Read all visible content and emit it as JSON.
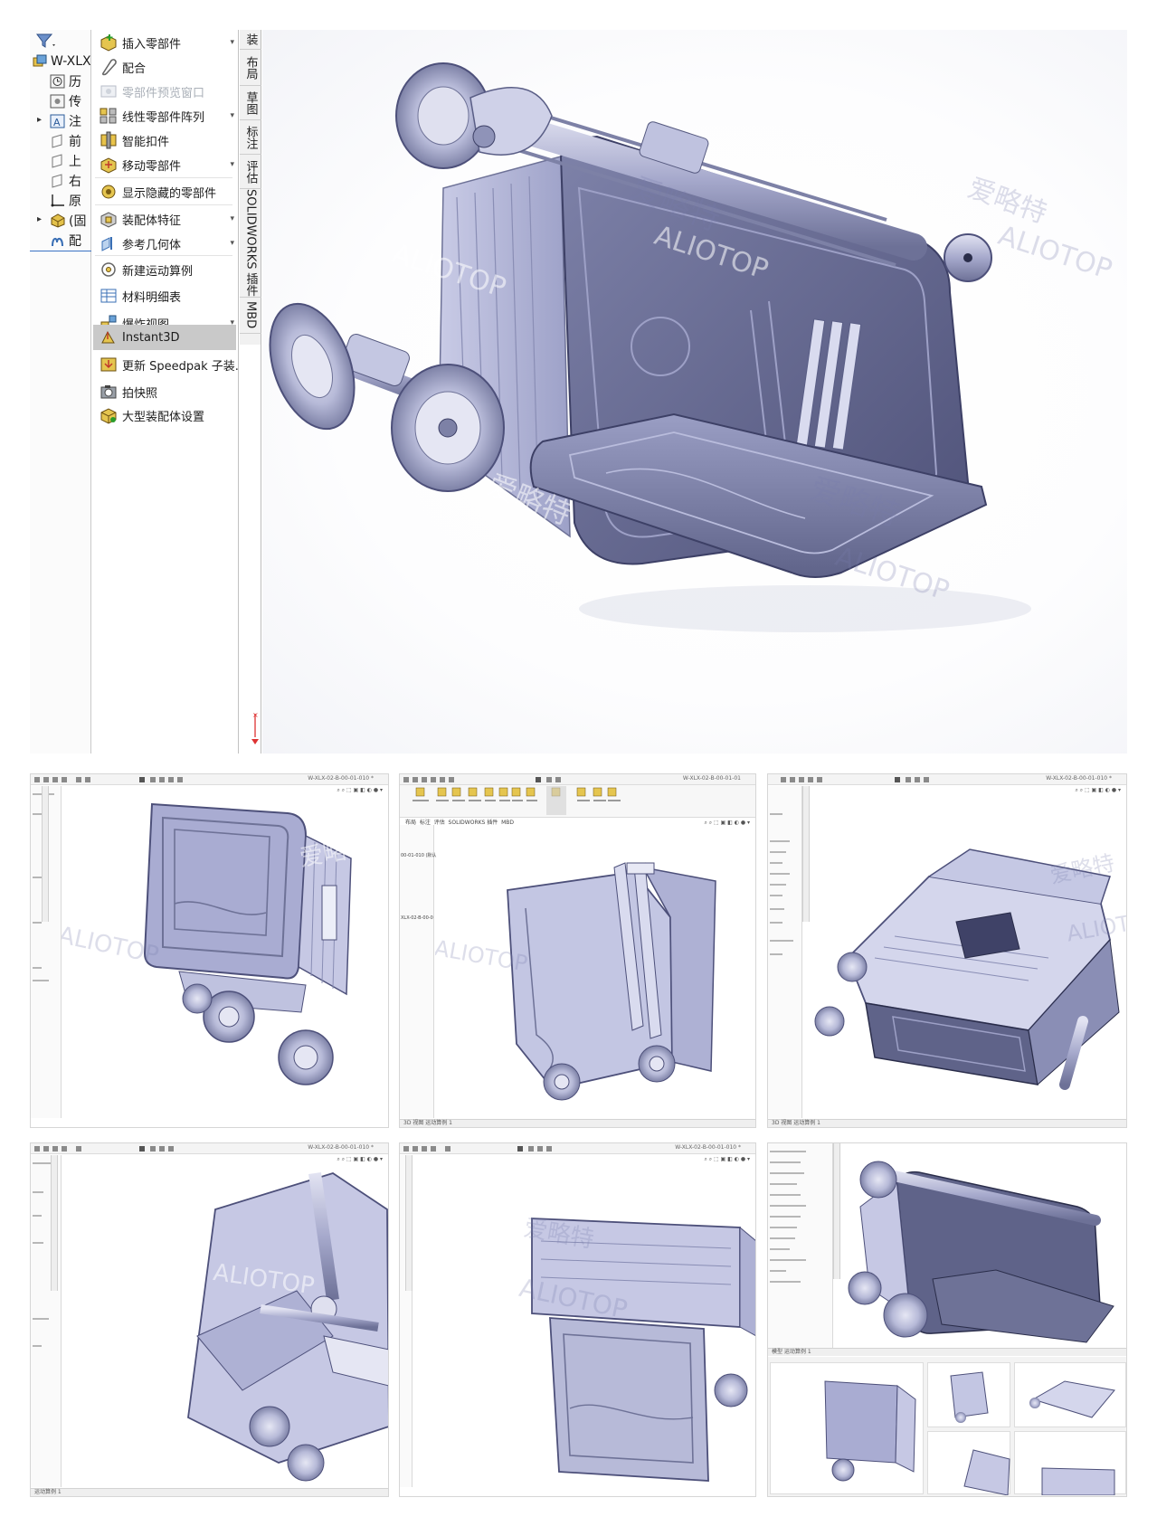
{
  "feature_tree": {
    "items": [
      {
        "label": "W-XLX",
        "icon": "assembly-icon"
      },
      {
        "label": "历",
        "icon": "history-icon"
      },
      {
        "label": "传",
        "icon": "sensors-icon"
      },
      {
        "label": "注",
        "icon": "annotations-icon"
      },
      {
        "label": "前",
        "icon": "plane-icon"
      },
      {
        "label": "上",
        "icon": "plane-icon"
      },
      {
        "label": "右",
        "icon": "plane-icon"
      },
      {
        "label": "原",
        "icon": "origin-icon"
      },
      {
        "label": "(固",
        "icon": "part-icon"
      },
      {
        "label": "配",
        "icon": "mates-icon"
      }
    ]
  },
  "command_menu": {
    "items": [
      {
        "label": "插入零部件",
        "icon": "insert-component-icon",
        "dropdown": true,
        "state": "normal"
      },
      {
        "label": "配合",
        "icon": "mate-icon",
        "dropdown": false,
        "state": "normal"
      },
      {
        "label": "零部件预览窗口",
        "icon": "preview-window-icon",
        "dropdown": false,
        "state": "disabled"
      },
      {
        "label": "线性零部件阵列",
        "icon": "linear-pattern-icon",
        "dropdown": true,
        "state": "normal"
      },
      {
        "label": "智能扣件",
        "icon": "smart-fasteners-icon",
        "dropdown": false,
        "state": "normal"
      },
      {
        "label": "移动零部件",
        "icon": "move-component-icon",
        "dropdown": true,
        "state": "normal"
      },
      {
        "label": "显示隐藏的零部件",
        "icon": "show-hidden-icon",
        "dropdown": false,
        "state": "normal"
      },
      {
        "label": "装配体特征",
        "icon": "assembly-feature-icon",
        "dropdown": true,
        "state": "normal"
      },
      {
        "label": "参考几何体",
        "icon": "reference-geometry-icon",
        "dropdown": true,
        "state": "normal"
      },
      {
        "label": "新建运动算例",
        "icon": "motion-study-icon",
        "dropdown": false,
        "state": "normal"
      },
      {
        "label": "材料明细表",
        "icon": "bom-icon",
        "dropdown": false,
        "state": "normal"
      },
      {
        "label": "爆炸视图",
        "icon": "exploded-view-icon",
        "dropdown": true,
        "state": "normal"
      },
      {
        "label": "Instant3D",
        "icon": "instant3d-icon",
        "dropdown": false,
        "state": "active"
      },
      {
        "label": "更新 Speedpak 子装...",
        "icon": "speedpak-icon",
        "dropdown": false,
        "state": "normal"
      },
      {
        "label": "拍快照",
        "icon": "snapshot-icon",
        "dropdown": false,
        "state": "normal"
      },
      {
        "label": "大型装配体设置",
        "icon": "large-assembly-icon",
        "dropdown": false,
        "state": "normal"
      }
    ]
  },
  "command_tabs": [
    "装",
    "布局",
    "草图",
    "标注",
    "评估",
    "SOLIDWORKS 插件",
    "MBD"
  ],
  "watermarks": {
    "cn": "爱略特",
    "en": "ALIOTOP"
  },
  "thumbnails": [
    {
      "title": "W-XLX-02-B-00-01-010 *",
      "status": "",
      "view": "front-left"
    },
    {
      "title": "W-XLX-02-B-00-01-01",
      "status": "3D 视图   运动算例 1",
      "view": "rear-handle",
      "left_labels": [
        "00-01-010 (默认",
        "XLX-02-B-00-0"
      ],
      "ribbon_tabs": [
        "布局",
        "标注",
        "评估",
        "SOLIDWORKS 插件",
        "MBD"
      ]
    },
    {
      "title": "W-XLX-02-B-00-01-010 *",
      "status": "3D 视图   运动算例 1",
      "view": "top-open"
    },
    {
      "title": "W-XLX-02-B-00-01-010 *",
      "status": "运动算例 1",
      "view": "underside"
    },
    {
      "title": "W-XLX-02-B-00-01-010 *",
      "status": "",
      "view": "side-tilt"
    },
    {
      "title": "",
      "status": "模型   运动算例 1",
      "view": "collage"
    }
  ]
}
